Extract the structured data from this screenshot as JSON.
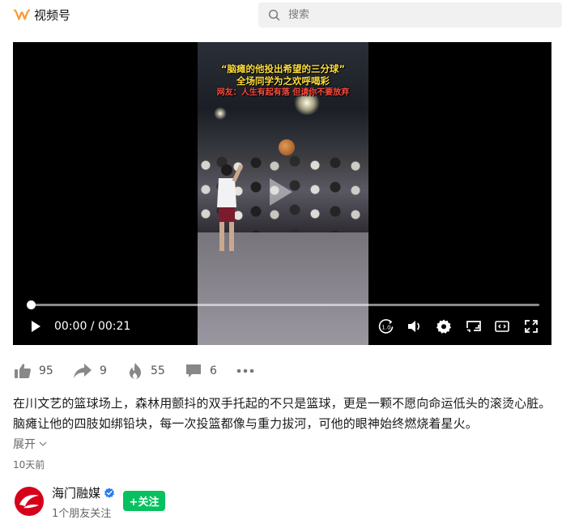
{
  "app": {
    "name": "视频号"
  },
  "search": {
    "placeholder": "搜索"
  },
  "video": {
    "caption_line1": "“脑瘫的他投出希望的三分球”",
    "caption_line2": "全场同学为之欢呼喝彩",
    "caption_line3": "网友：人生有起有落 但请你不要放弃",
    "current_time": "00:00",
    "duration": "00:21",
    "time_display": "00:00 / 00:21",
    "progress_fraction": 0.0
  },
  "actions": {
    "likes": "95",
    "shares": "9",
    "hot": "55",
    "comments": "6"
  },
  "description": "在川文艺的篮球场上，森林用颤抖的双手托起的不只是篮球，更是一颗不愿向命运低头的滚烫心脏。脑瘫让他的四肢如绑铅块，每一次投篮都像与重力拔河，可他的眼神始终燃烧着星火。",
  "expand_label": "展开",
  "post_date": "10天前",
  "author": {
    "name": "海门融媒",
    "friends_following": "1个朋友关注",
    "follow_label": "+关注"
  },
  "colors": {
    "brand": "#fa9d3b",
    "follow_green": "#07c160",
    "verified_blue": "#2b7cf6",
    "avatar_red": "#d7001b"
  }
}
